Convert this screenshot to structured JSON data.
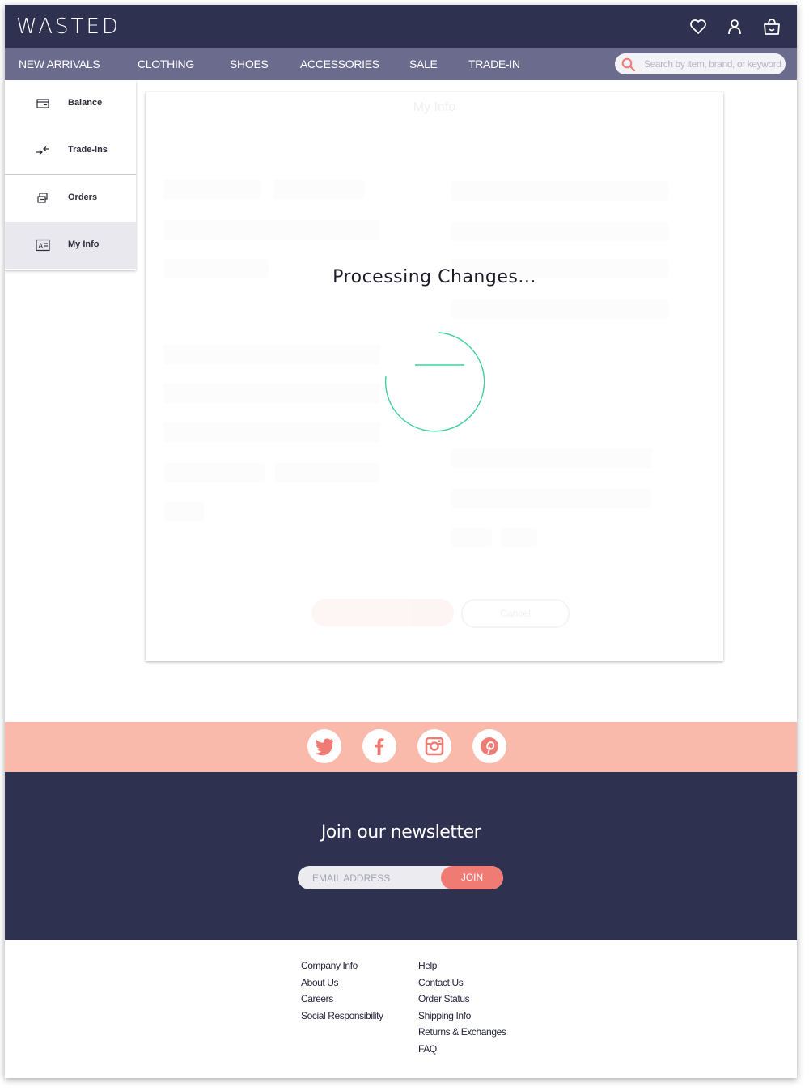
{
  "brand": {
    "logo": "WASTED"
  },
  "header": {
    "icons": [
      "heart-icon",
      "user-icon",
      "bag-icon"
    ]
  },
  "nav": {
    "items": [
      "NEW ARRIVALS",
      "CLOTHING",
      "SHOES",
      "ACCESSORIES",
      "SALE",
      "TRADE-IN"
    ],
    "search_placeholder": "Search by item, brand, or keyword"
  },
  "sidebar": {
    "items": [
      {
        "label": "Balance",
        "icon": "wallet-icon"
      },
      {
        "label": "Trade-Ins",
        "icon": "exchange-icon"
      },
      {
        "label": "Orders",
        "icon": "orders-icon"
      },
      {
        "label": "My Info",
        "icon": "id-card-icon",
        "active": true
      }
    ]
  },
  "main": {
    "title": "My Info",
    "status": "Processing Changes...",
    "cancel_label": "Cancel"
  },
  "social": {
    "icons": [
      "twitter-icon",
      "facebook-icon",
      "instagram-icon",
      "pinterest-icon"
    ]
  },
  "newsletter": {
    "title": "Join our newsletter",
    "email_placeholder": "EMAIL ADDRESS",
    "join_label": "JOIN"
  },
  "footer": {
    "company": {
      "heading": "Company Info",
      "links": [
        "About Us",
        "Careers",
        "Social Responsibility"
      ]
    },
    "help": {
      "heading": "Help",
      "links": [
        "Contact Us",
        "Order Status",
        "Shipping Info",
        "Returns & Exchanges",
        "FAQ"
      ]
    }
  },
  "colors": {
    "navy": "#2e3150",
    "nav": "#6b6b8e",
    "coral": "#f07b74",
    "peach": "#f9b9ab",
    "spinner": "#3ecfa0"
  }
}
